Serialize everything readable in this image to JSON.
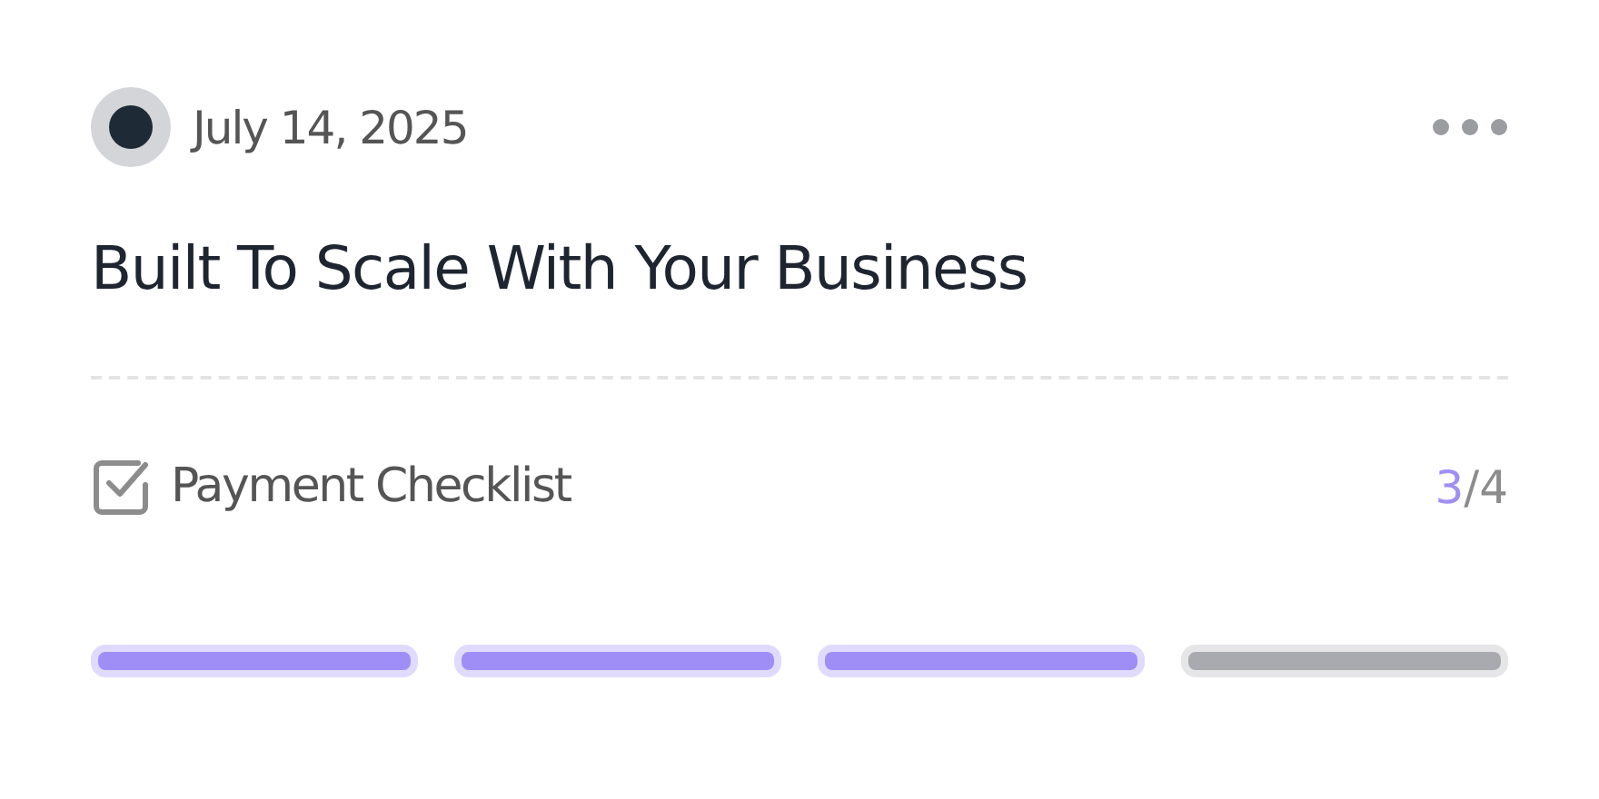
{
  "date": "July 14, 2025",
  "title": "Built To Scale With Your Business",
  "checklist": {
    "label": "Payment Checklist",
    "checked": true,
    "count": {
      "done": "3",
      "separator": "/",
      "total": "4"
    }
  },
  "segments": [
    {
      "completed": true
    },
    {
      "completed": true
    },
    {
      "completed": true
    },
    {
      "completed": false
    }
  ]
}
